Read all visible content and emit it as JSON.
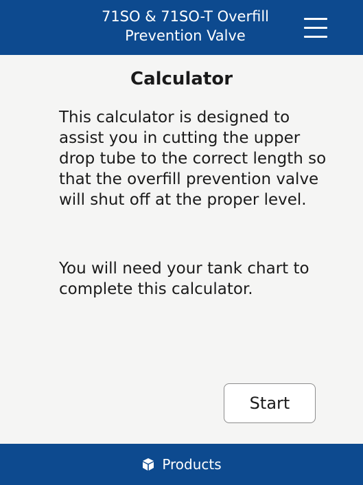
{
  "header": {
    "title_line1": "71SO & 71SO-T Overfill",
    "title_line2": "Prevention Valve",
    "menu_icon": "hamburger-menu-icon"
  },
  "main": {
    "title": "Calculator",
    "description": "This calculator is designed to assist you in cutting the upper drop tube to the correct length so that the overfill prevention valve will shut off at the proper level.",
    "note": "You will need your tank chart to complete this calculator.",
    "start_label": "Start"
  },
  "footer": {
    "nav_label": "Products",
    "nav_icon": "box-icon"
  },
  "colors": {
    "brand": "#0d4a8f",
    "background": "#f5f5f4",
    "text": "#1a1a1a"
  }
}
